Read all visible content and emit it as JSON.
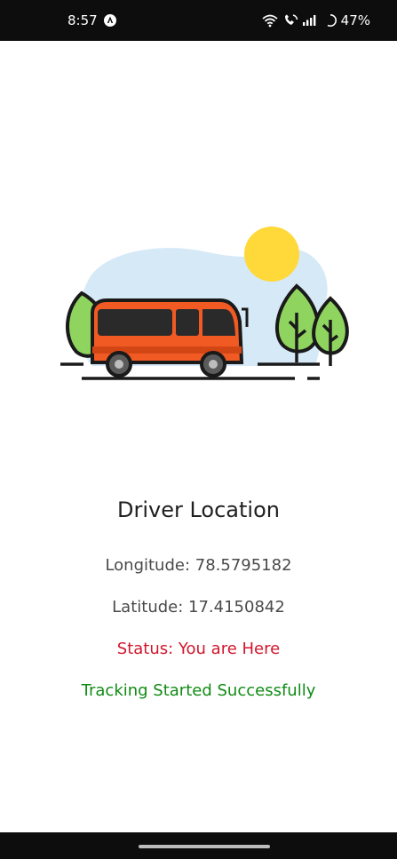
{
  "status_bar": {
    "time": "8:57",
    "battery": "47%",
    "icons": [
      "app-notification-icon",
      "wifi-icon",
      "volte-icon",
      "signal-icon",
      "battery-icon"
    ]
  },
  "main": {
    "title": "Driver Location",
    "longitude_text": "Longitude: 78.5795182",
    "latitude_text": "Latitude: 17.4150842",
    "status_text": "Status: You are Here",
    "tracking_text": "Tracking Started Successfully"
  },
  "colors": {
    "status_red": "#d1162b",
    "success_green": "#108b14",
    "bus_orange": "#f25a24",
    "tree_green": "#8fd45f",
    "sun_yellow": "#ffd83a",
    "sky_blue": "#d6e9f7"
  }
}
